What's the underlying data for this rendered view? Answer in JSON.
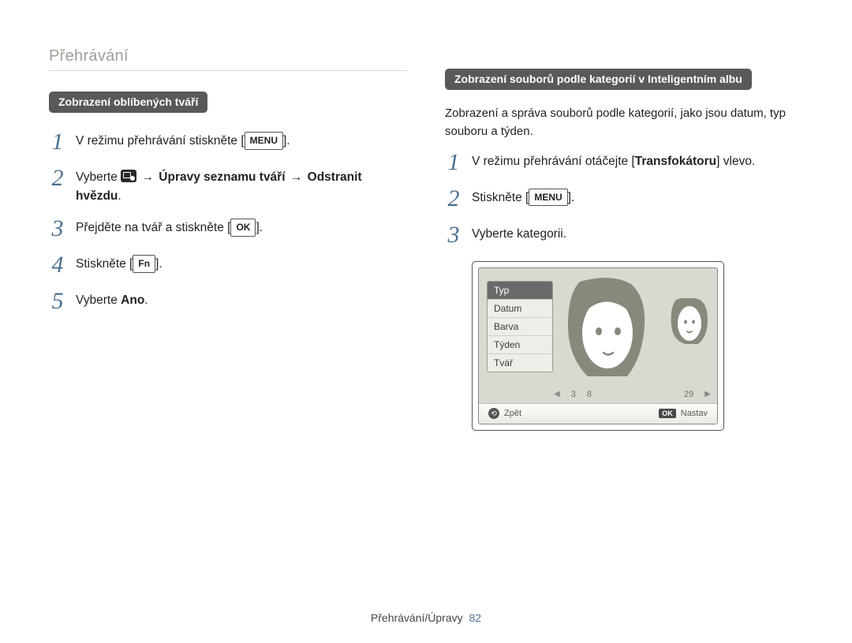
{
  "header": {
    "title": "Přehrávání"
  },
  "left": {
    "pill": "Zobrazení oblíbených tváří",
    "steps": [
      {
        "n": "1",
        "pre": "V režimu přehrávání stiskněte [",
        "key": "MENU",
        "post": "]."
      },
      {
        "n": "2",
        "html": "Vyberte {ICON} <span class='arrow'>→</span> <b>Úpravy seznamu tváří</b> <span class='arrow'>→</span> <b>Odstranit hvězdu</b>."
      },
      {
        "n": "3",
        "pre": "Přejděte na tvář a stiskněte [",
        "key": "OK",
        "post": "]."
      },
      {
        "n": "4",
        "pre": "Stiskněte [",
        "key": "Fn",
        "post": "]."
      },
      {
        "n": "5",
        "html": "Vyberte <b>Ano</b>."
      }
    ]
  },
  "right": {
    "pill": "Zobrazení souborů podle kategorií v Inteligentním albu",
    "intro": "Zobrazení a správa souborů podle kategorií, jako jsou datum, typ souboru a týden.",
    "steps": [
      {
        "n": "1",
        "html": "V režimu přehrávání otáčejte [<b>Transfokátoru</b>] vlevo."
      },
      {
        "n": "2",
        "pre": "Stiskněte [",
        "key": "MENU",
        "post": "]."
      },
      {
        "n": "3",
        "html": "Vyberte kategorii."
      }
    ],
    "screen": {
      "menu": [
        "Typ",
        "Datum",
        "Barva",
        "Týden",
        "Tvář"
      ],
      "selected": 0,
      "back": "Zpět",
      "set": "Nastav",
      "strip_nums": [
        "3",
        "8",
        "",
        "29"
      ]
    }
  },
  "footer": {
    "label": "Přehrávání/Úpravy",
    "page": "82"
  }
}
